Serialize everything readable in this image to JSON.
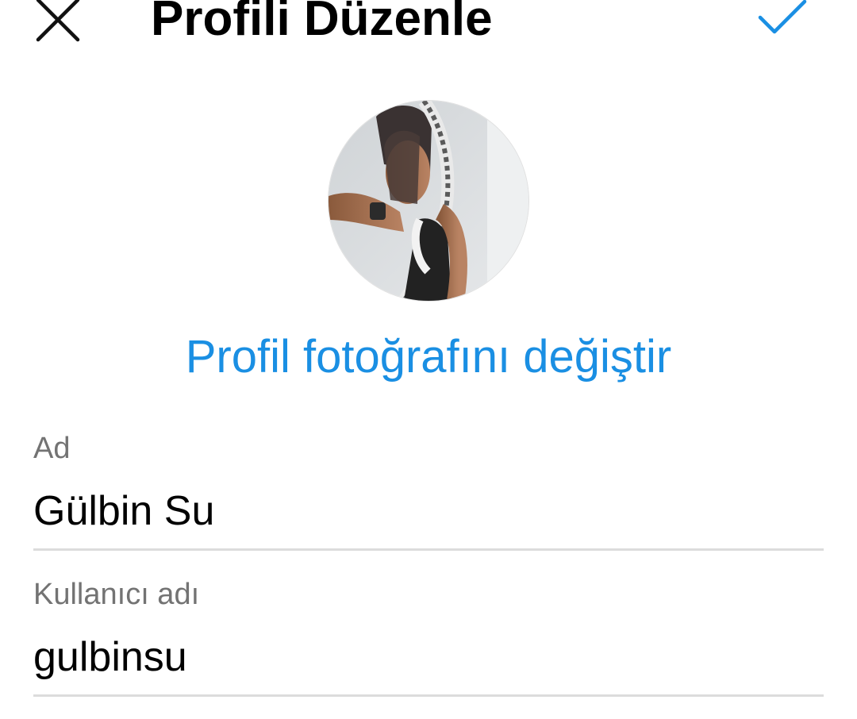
{
  "header": {
    "title": "Profili Düzenle",
    "close_icon": "close-icon",
    "confirm_icon": "checkmark-icon",
    "accent_color": "#1a8fe3"
  },
  "profile": {
    "avatar_icon": "profile-photo",
    "change_photo_label": "Profil fotoğrafını değiştir"
  },
  "form": {
    "name": {
      "label": "Ad",
      "value": "Gülbin Su"
    },
    "username": {
      "label": "Kullanıcı adı",
      "value": "gulbinsu"
    }
  }
}
